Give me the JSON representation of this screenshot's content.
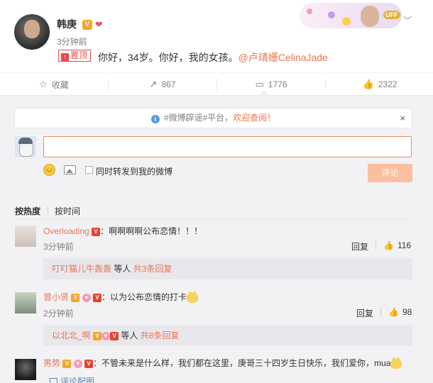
{
  "post": {
    "author": "韩庚",
    "time": "3分钟前",
    "pin_label": "置顶",
    "text": "你好，34岁。你好，我的女孩。",
    "mention": "@卢靖姗CelinaJade",
    "card_label": "UFF"
  },
  "actions": {
    "favorite": "收藏",
    "repost": "867",
    "comment": "1776",
    "like": "2322"
  },
  "notice": {
    "prefix": "#微博辟谣#平台，",
    "highlight": "欢迎查阅！",
    "close": "×"
  },
  "composer": {
    "input_value": "",
    "repost_label": "同时转发到我的微博",
    "submit_label": "评论"
  },
  "sort_tabs": {
    "hot": "按热度",
    "time": "按时间"
  },
  "comments": [
    {
      "name": "Overloading",
      "text": "：啊啊啊啊公布恋情！！！",
      "time": "3分钟前",
      "reply": "回复",
      "likes": "116",
      "sub_name": "叮叮猫儿牛轰轰",
      "sub_mid": " 等人 ",
      "sub_total": "共3条回复"
    },
    {
      "name": "曾小贤",
      "text": "：以为公布恋情的打卡",
      "time": "2分钟前",
      "reply": "回复",
      "likes": "98",
      "sub_name": "以北北_啊",
      "sub_mid": " 等人 ",
      "sub_total": "共8条回复"
    },
    {
      "name": "男势",
      "text": "：不管未来是什么样，我们都在这里，庚哥三十四岁生日快乐，我们爱你，mua",
      "pic_label": "评论配图"
    }
  ]
}
